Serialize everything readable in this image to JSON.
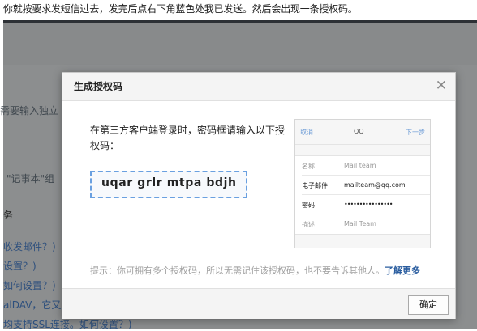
{
  "instruction": "你就按要求发短信过去，发完后点右下角蓝色处我已发送。然后会出现一条授权码。",
  "background": {
    "fragments": [
      {
        "text": "需要输入独立"
      },
      {
        "text": "\"记事本\"组"
      },
      {
        "text": "务"
      },
      {
        "text": "收发邮件？)"
      },
      {
        "text": "设置？)"
      },
      {
        "text": "如何设置？)"
      },
      {
        "text": "alDAV，它又是"
      },
      {
        "text": "均支持SSL连接。如何设置？)"
      }
    ]
  },
  "dialog": {
    "title": "生成授权码",
    "close_icon": "close-icon",
    "prompt": "在第三方客户端登录时，密码框请输入以下授权码：",
    "auth_code": "uqar grlr mtpa bdjh",
    "phone": {
      "cancel": "取消",
      "title": "QQ",
      "next": "下一步",
      "rows": [
        {
          "label": "名称",
          "value": "Mail team"
        },
        {
          "label": "电子邮件",
          "value": "mailteam@qq.com"
        },
        {
          "label": "密码",
          "value": "••••••••••••••••"
        },
        {
          "label": "描述",
          "value": "Mail Team"
        }
      ]
    },
    "tip": "提示：你可拥有多个授权码，所以无需记住该授权码，也不要告诉其他人。",
    "tip_link": "了解更多",
    "ok_label": "确定"
  }
}
